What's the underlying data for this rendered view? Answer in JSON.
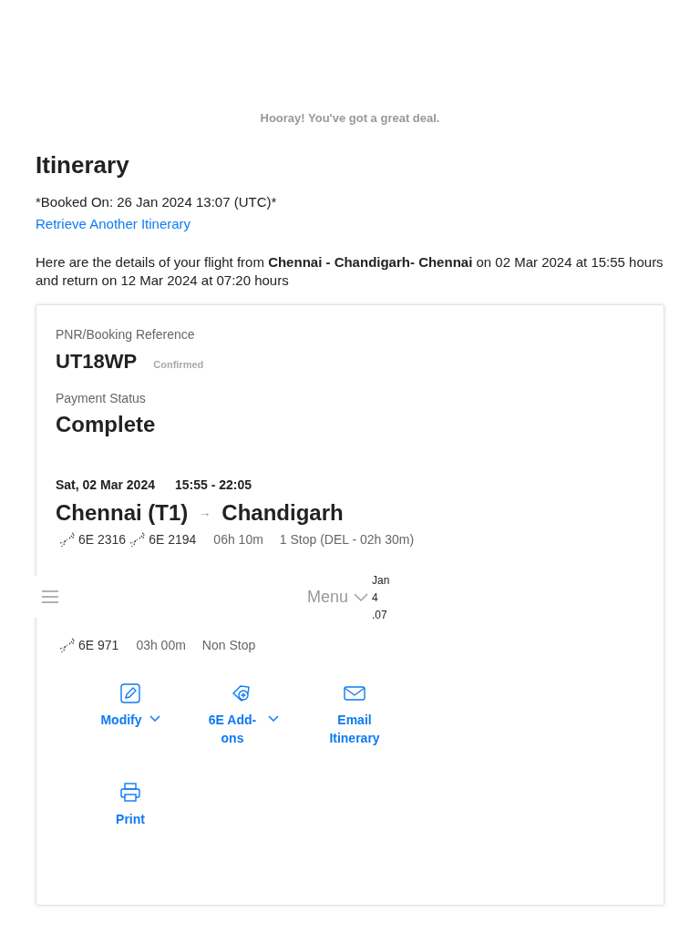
{
  "banner": "Hooray! You've got a great deal.",
  "title": "Itinerary",
  "booked_on": "*Booked On: 26 Jan 2024 13:07 (UTC)*",
  "retrieve_link": "Retrieve Another Itinerary",
  "summary": "Here are the details of your flight from **Chennai - Chandigarh- Chennai** on 02 Mar 2024 at 15:55 hours and return on 12 Mar 2024 at 07:20 hours",
  "booking": {
    "pnr_label": "PNR/Booking Reference",
    "pnr": "UT18WP",
    "status": "Confirmed",
    "payment_label": "Payment Status",
    "payment": "Complete"
  },
  "legs": [
    {
      "date": "Sat, 02 Mar 2024",
      "time": "15:55 - 22:05",
      "from": "Chennai (T1)",
      "arrow": "→",
      "to": "Chandigarh",
      "flights": [
        "6E 2316",
        "6E 2194"
      ],
      "duration": "06h 10m",
      "stops": "1 Stop (DEL - 02h 30m)"
    },
    {
      "flights": [
        "6E 971"
      ],
      "duration": "03h 00m",
      "stops": "Non Stop"
    }
  ],
  "menu_bar": {
    "label": "Menu",
    "side_text": [
      "Jan",
      "4",
      ".07"
    ]
  },
  "actions": [
    {
      "kind": "edit",
      "label": "Modify",
      "dropdown": true
    },
    {
      "kind": "addons",
      "label": "6E Add-ons",
      "dropdown": true
    },
    {
      "kind": "email",
      "label": "Email Itinerary",
      "dropdown": false
    },
    {
      "kind": "print",
      "label": "Print",
      "dropdown": false
    }
  ]
}
